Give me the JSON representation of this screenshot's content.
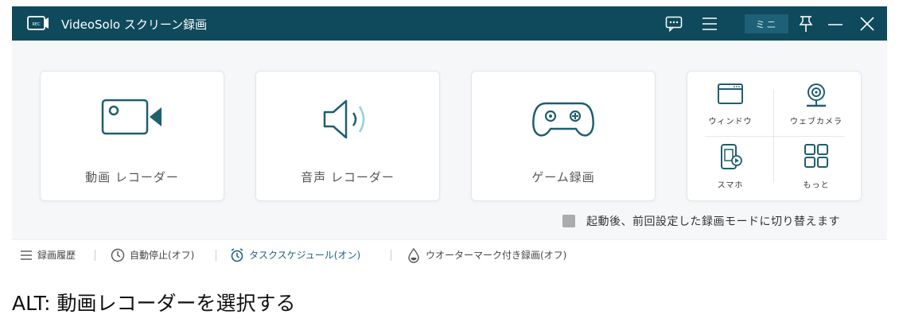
{
  "app": {
    "title": "VideoSolo スクリーン録画",
    "logo_text": "REC",
    "mini_label": "ミニ"
  },
  "cards": {
    "video": "動画 レコーダー",
    "audio": "音声 レコーダー",
    "game": "ゲーム録画"
  },
  "more_modes": {
    "window": "ウィンドウ",
    "webcam": "ウェブカメラ",
    "phone": "スマホ",
    "more": "もっと"
  },
  "auto_switch": {
    "label": "起動後、前回設定した録画モードに切り替えます",
    "checked": true
  },
  "bottom_bar": {
    "history": "録画履歴",
    "auto_stop": "自動停止(オフ)",
    "schedule": "タスクスケジュール(オン)",
    "watermark": "ウオーターマーク付き録画(オフ)"
  },
  "alt_text": "ALT:  動画レコーダーを選択する",
  "colors": {
    "titlebar": "#0f4a5c",
    "accent_teal": "#1f5f6e",
    "schedule_blue": "#1a6385"
  }
}
